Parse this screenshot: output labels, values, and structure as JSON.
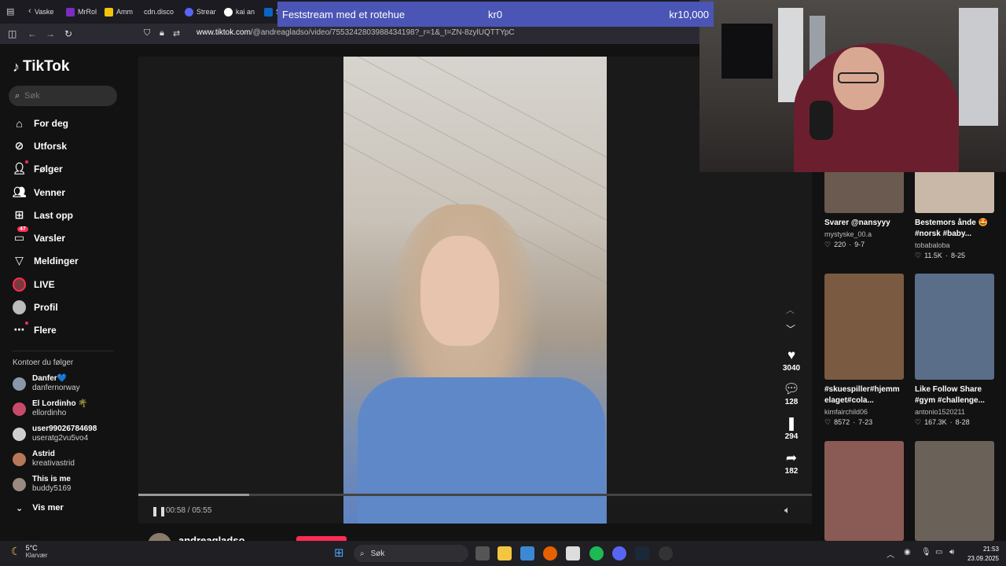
{
  "browser": {
    "tabs": [
      {
        "label": "Vaske",
        "color": "#555"
      },
      {
        "label": "MrRol",
        "color": "#7b2cbf"
      },
      {
        "label": "Amm",
        "color": "#f4c20d"
      },
      {
        "label": "cdn.disco",
        "color": "#333"
      },
      {
        "label": "Strean",
        "color": "#5865f2"
      },
      {
        "label": "kai an",
        "color": "#fff"
      },
      {
        "label": "S",
        "color": "#0a66c2"
      }
    ],
    "url_host": "www.tiktok.com",
    "url_path": "/@andreagladso/video/7553242803988434198?_r=1&_t=ZN-8zylUQTTYpC"
  },
  "sidebar": {
    "logo": "TikTok",
    "search_placeholder": "Søk",
    "nav": [
      {
        "label": "For deg",
        "icon": "home-icon"
      },
      {
        "label": "Utforsk",
        "icon": "compass-icon"
      },
      {
        "label": "Følger",
        "icon": "following-icon"
      },
      {
        "label": "Venner",
        "icon": "friends-icon"
      },
      {
        "label": "Last opp",
        "icon": "upload-icon"
      },
      {
        "label": "Varsler",
        "icon": "inbox-icon",
        "badge": "47"
      },
      {
        "label": "Meldinger",
        "icon": "messages-icon"
      },
      {
        "label": "LIVE",
        "icon": "live-icon"
      },
      {
        "label": "Profil",
        "icon": "profile-icon"
      },
      {
        "label": "Flere",
        "icon": "more-icon"
      }
    ],
    "following_title": "Kontoer du følger",
    "accounts": [
      {
        "name": "Danfer💙",
        "user": "danfernorway",
        "color": "#8899aa"
      },
      {
        "name": "El Lordinho 🌴",
        "user": "ellordinho",
        "color": "#c74a6a"
      },
      {
        "name": "user99026784698",
        "user": "useratg2vu5vo4",
        "color": "#cfcfcf"
      },
      {
        "name": "Astrid",
        "user": "kreativastrid",
        "color": "#b7785a"
      },
      {
        "name": "This is me",
        "user": "buddy5169",
        "color": "#9a8a80"
      }
    ],
    "show_more": "Vis mer"
  },
  "player": {
    "progress": 0.164,
    "time_current": "00:58",
    "time_total": "05:55",
    "likes": "3040",
    "comments": "128",
    "saves": "294",
    "shares": "182",
    "author": "andreagladso"
  },
  "donation": {
    "title": "Feststream med et rotehue",
    "current": "kr0",
    "goal": "kr10,000"
  },
  "grid": [
    {
      "title": "Svarer @nansyyy",
      "user": "mystyske_00.a",
      "likes": "220",
      "date": "9-7",
      "color": "#6b5a50"
    },
    {
      "title": "Bestemors ånde 🤩\n#norsk #baby...",
      "user": "tobabaloba",
      "likes": "11.5K",
      "date": "8-25",
      "color": "#c9b8a8"
    },
    {
      "title": "#skuespiller#hjemm\nelaget#cola...",
      "user": "kimfairchild06",
      "likes": "8572",
      "date": "7-23",
      "color": "#7a5a40"
    },
    {
      "title": "Like Follow Share\n#gym #challenge...",
      "user": "antonio1520211",
      "likes": "167.3K",
      "date": "8-28",
      "color": "#5a6e8a"
    },
    {
      "title": "",
      "user": "",
      "likes": "",
      "date": "",
      "color": "#8a5a55"
    },
    {
      "title": "",
      "user": "",
      "likes": "",
      "date": "",
      "color": "#6a6258"
    }
  ],
  "taskbar": {
    "temp": "5°C",
    "weather": "Klarvær",
    "search": "Søk",
    "time": "21:53",
    "date": "23.09.2025"
  }
}
